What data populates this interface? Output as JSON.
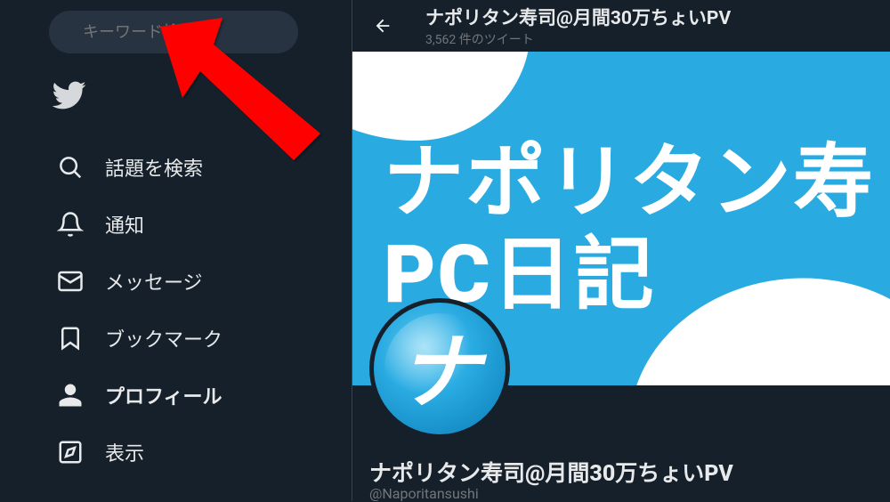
{
  "search": {
    "placeholder": "キーワード検索"
  },
  "nav": {
    "explore": "話題を検索",
    "notifications": "通知",
    "messages": "メッセージ",
    "bookmarks": "ブックマーク",
    "profile": "プロフィール",
    "display": "表示"
  },
  "header": {
    "title": "ナポリタン寿司@月間30万ちょいPV",
    "subtitle": "3,562 件のツイート"
  },
  "cover": {
    "line1": "ナポリタン寿",
    "line2": "PC日記"
  },
  "avatar": {
    "letter": "ナ"
  },
  "profile": {
    "name": "ナポリタン寿司@月間30万ちょいPV",
    "handle": "@Naporitansushi"
  },
  "colors": {
    "bg": "#15202b",
    "accent": "#29abe2",
    "text": "#e7e9ea",
    "muted": "#71767b"
  }
}
